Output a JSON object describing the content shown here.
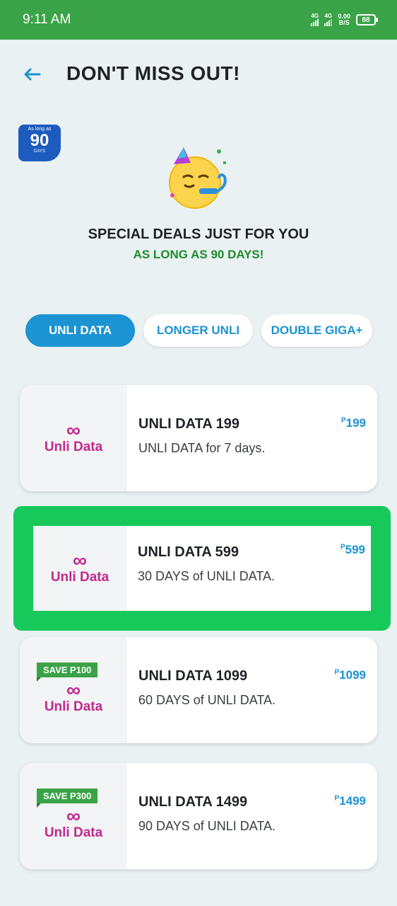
{
  "status_bar": {
    "time": "9:11 AM",
    "network1": "4G",
    "network2": "4G",
    "speed_value": "0.00",
    "speed_unit": "B/S",
    "battery": "88"
  },
  "header": {
    "title": "DON'T MISS OUT!"
  },
  "badge": {
    "top_text": "As long as",
    "number": "90",
    "bottom_text": "DAYS"
  },
  "promo": {
    "title": "SPECIAL DEALS JUST FOR YOU",
    "subtitle": "AS LONG AS 90 DAYS!"
  },
  "tabs": [
    {
      "label": "UNLI DATA",
      "active": true
    },
    {
      "label": "LONGER UNLI",
      "active": false
    },
    {
      "label": "DOUBLE GIGA+",
      "active": false
    }
  ],
  "logo": {
    "symbol": "∞",
    "text": "Unli Data"
  },
  "plans": [
    {
      "name": "UNLI DATA 199",
      "description": "UNLI DATA for 7 days.",
      "currency": "P",
      "price": "199",
      "save": ""
    },
    {
      "name": "UNLI DATA 599",
      "description": "30 DAYS of UNLI DATA.",
      "currency": "P",
      "price": "599",
      "save": ""
    },
    {
      "name": "UNLI DATA 1099",
      "description": "60 DAYS of UNLI DATA.",
      "currency": "P",
      "price": "1099",
      "save": "SAVE P100"
    },
    {
      "name": "UNLI DATA 1499",
      "description": "90 DAYS of UNLI DATA.",
      "currency": "P",
      "price": "1499",
      "save": "SAVE P300"
    }
  ],
  "colors": {
    "status_bar": "#3aa347",
    "accent_blue": "#1c93d2",
    "highlight_green": "#17c95a",
    "brand_magenta": "#c2288d",
    "subtitle_green": "#1d8b2c"
  }
}
